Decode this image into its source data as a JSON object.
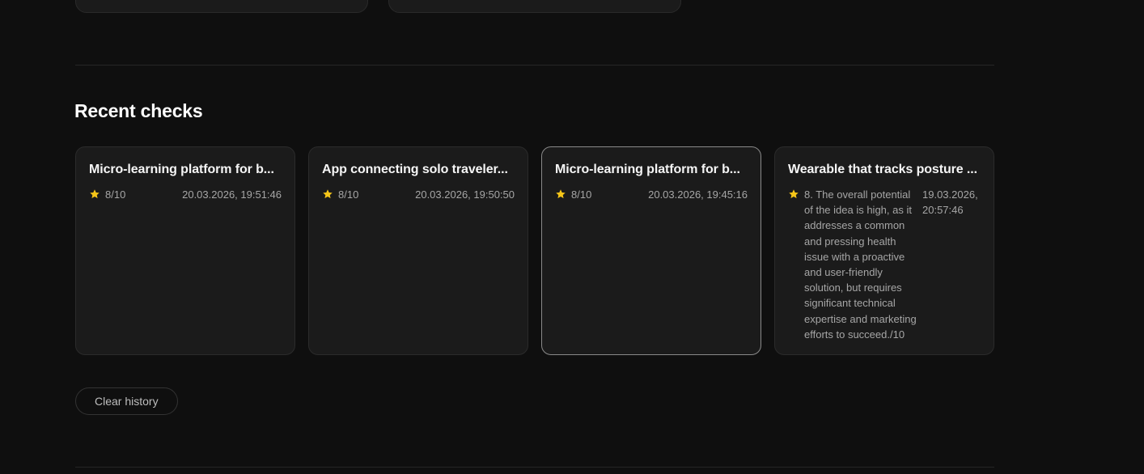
{
  "section": {
    "title": "Recent checks"
  },
  "cards": [
    {
      "title": "Micro-learning platform for b...",
      "score": "8/10",
      "date": "20.03.2026, 19:51:46"
    },
    {
      "title": "App connecting solo traveler...",
      "score": "8/10",
      "date": "20.03.2026, 19:50:50"
    },
    {
      "title": "Micro-learning platform for b...",
      "score": "8/10",
      "date": "20.03.2026, 19:45:16"
    },
    {
      "title": "Wearable that tracks posture ...",
      "score": "8. The overall potential of the idea is high, as it addresses a common and pressing health issue with a proactive and user-friendly solution, but requires significant technical expertise and marketing efforts to succeed./10",
      "date": "19.03.2026, 20:57:46"
    }
  ],
  "actions": {
    "clear_history_label": "Clear history"
  },
  "colors": {
    "background": "#0f0f0f",
    "card": "#1b1b1b",
    "star": "#f5c518",
    "selected_border": "#8a8a8a"
  },
  "icons": {
    "score": "star-icon"
  }
}
